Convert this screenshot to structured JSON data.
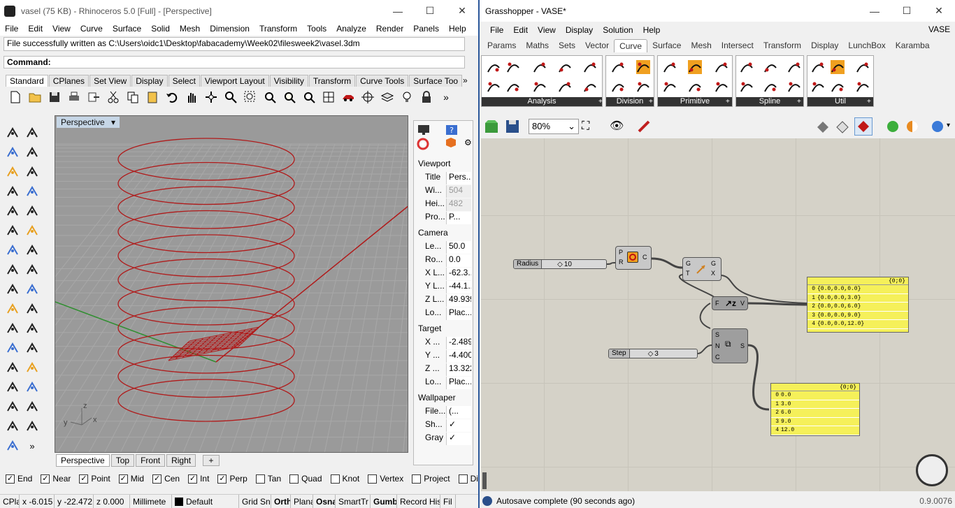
{
  "rhino": {
    "title": "vasel (75 KB) - Rhinoceros 5.0 [Full] - [Perspective]",
    "menu": [
      "File",
      "Edit",
      "View",
      "Curve",
      "Surface",
      "Solid",
      "Mesh",
      "Dimension",
      "Transform",
      "Tools",
      "Analyze",
      "Render",
      "Panels",
      "Help"
    ],
    "history_line": "File successfully written as C:\\Users\\oidc1\\Desktop\\fabacademy\\Week02\\filesweek2\\vasel.3dm",
    "command_label": "Command:",
    "toolbar_tabs": [
      "Standard",
      "CPlanes",
      "Set View",
      "Display",
      "Select",
      "Viewport Layout",
      "Visibility",
      "Transform",
      "Curve Tools",
      "Surface Too"
    ],
    "active_tab": "Standard",
    "viewport_label": "Perspective",
    "viewport_tabs": [
      "Perspective",
      "Top",
      "Front",
      "Right"
    ],
    "axis": {
      "x": "x",
      "y": "y",
      "z": "z"
    },
    "properties": {
      "section_viewport": "Viewport",
      "viewport_rows": [
        {
          "k": "Title",
          "v": "Pers..."
        },
        {
          "k": "Wi...",
          "v": "504",
          "dis": true
        },
        {
          "k": "Hei...",
          "v": "482",
          "dis": true
        },
        {
          "k": "Pro...",
          "v": "P..."
        }
      ],
      "section_camera": "Camera",
      "camera_rows": [
        {
          "k": "Le...",
          "v": "50.0"
        },
        {
          "k": "Ro...",
          "v": "0.0"
        },
        {
          "k": "X L...",
          "v": "-62.3..."
        },
        {
          "k": "Y L...",
          "v": "-44.1..."
        },
        {
          "k": "Z L...",
          "v": "49.939"
        },
        {
          "k": "Lo...",
          "v": "Plac..."
        }
      ],
      "section_target": "Target",
      "target_rows": [
        {
          "k": "X ...",
          "v": "-2.489"
        },
        {
          "k": "Y ...",
          "v": "-4.400"
        },
        {
          "k": "Z ...",
          "v": "13.322"
        },
        {
          "k": "Lo...",
          "v": "Plac..."
        }
      ],
      "section_wallpaper": "Wallpaper",
      "wallpaper_rows": [
        {
          "k": "File...",
          "v": "(..."
        },
        {
          "k": "Sh...",
          "v": "✓"
        },
        {
          "k": "Gray",
          "v": "✓"
        }
      ]
    },
    "osnaps": [
      {
        "label": "End",
        "checked": true
      },
      {
        "label": "Near",
        "checked": true
      },
      {
        "label": "Point",
        "checked": true
      },
      {
        "label": "Mid",
        "checked": true
      },
      {
        "label": "Cen",
        "checked": true
      },
      {
        "label": "Int",
        "checked": true
      },
      {
        "label": "Perp",
        "checked": true
      },
      {
        "label": "Tan",
        "checked": false
      },
      {
        "label": "Quad",
        "checked": false
      },
      {
        "label": "Knot",
        "checked": false
      },
      {
        "label": "Vertex",
        "checked": false
      },
      {
        "label": "Project",
        "checked": false
      },
      {
        "label": "Disable",
        "checked": false
      }
    ],
    "status": {
      "cplane": "CPlar",
      "x": "x -6.015",
      "y": "y -22.472",
      "z": "z 0.000",
      "units": "Millimete",
      "layer": "Default",
      "grid_snap": "Grid Sn",
      "ortho": "Orth",
      "planar": "Plana",
      "osnap": "Osna",
      "smarttrack": "SmartTr",
      "gumball": "Gumb",
      "record": "Record His",
      "filter": "Fil"
    }
  },
  "gh": {
    "title": "Grasshopper - VASE*",
    "menu": [
      "File",
      "Edit",
      "View",
      "Display",
      "Solution",
      "Help"
    ],
    "doc_name": "VASE",
    "tabs": [
      "Params",
      "Maths",
      "Sets",
      "Vector",
      "Curve",
      "Surface",
      "Mesh",
      "Intersect",
      "Transform",
      "Display",
      "LunchBox",
      "Karamba"
    ],
    "active_tab": "Curve",
    "panels": [
      "Analysis",
      "Division",
      "Primitive",
      "Spline",
      "Util"
    ],
    "zoom": "80%",
    "nodes": {
      "radius_slider": {
        "name": "Radius",
        "value": "10"
      },
      "step_slider": {
        "name": "Step",
        "value": "3"
      },
      "circle": {
        "in": [
          "P",
          "R"
        ],
        "out": "C"
      },
      "move": {
        "in": [
          "G",
          "T"
        ],
        "out": [
          "G",
          "X"
        ]
      },
      "unitz": {
        "in": "F",
        "out": "V"
      },
      "series": {
        "in": [
          "S",
          "N",
          "C"
        ],
        "out": "S"
      }
    },
    "panel1": {
      "path": "{0;0}",
      "rows": [
        "{0.0,0.0,0.0}",
        "{0.0,0.0,3.0}",
        "{0.0,0.0,6.0}",
        "{0.0,0.0,9.0}",
        "{0.0,0.0,12.0}"
      ]
    },
    "panel2": {
      "path": "{0;0}",
      "rows": [
        "0.0",
        "3.0",
        "6.0",
        "9.0",
        "12.0"
      ]
    },
    "status": "Autosave complete (90 seconds ago)",
    "version": "0.9.0076"
  }
}
